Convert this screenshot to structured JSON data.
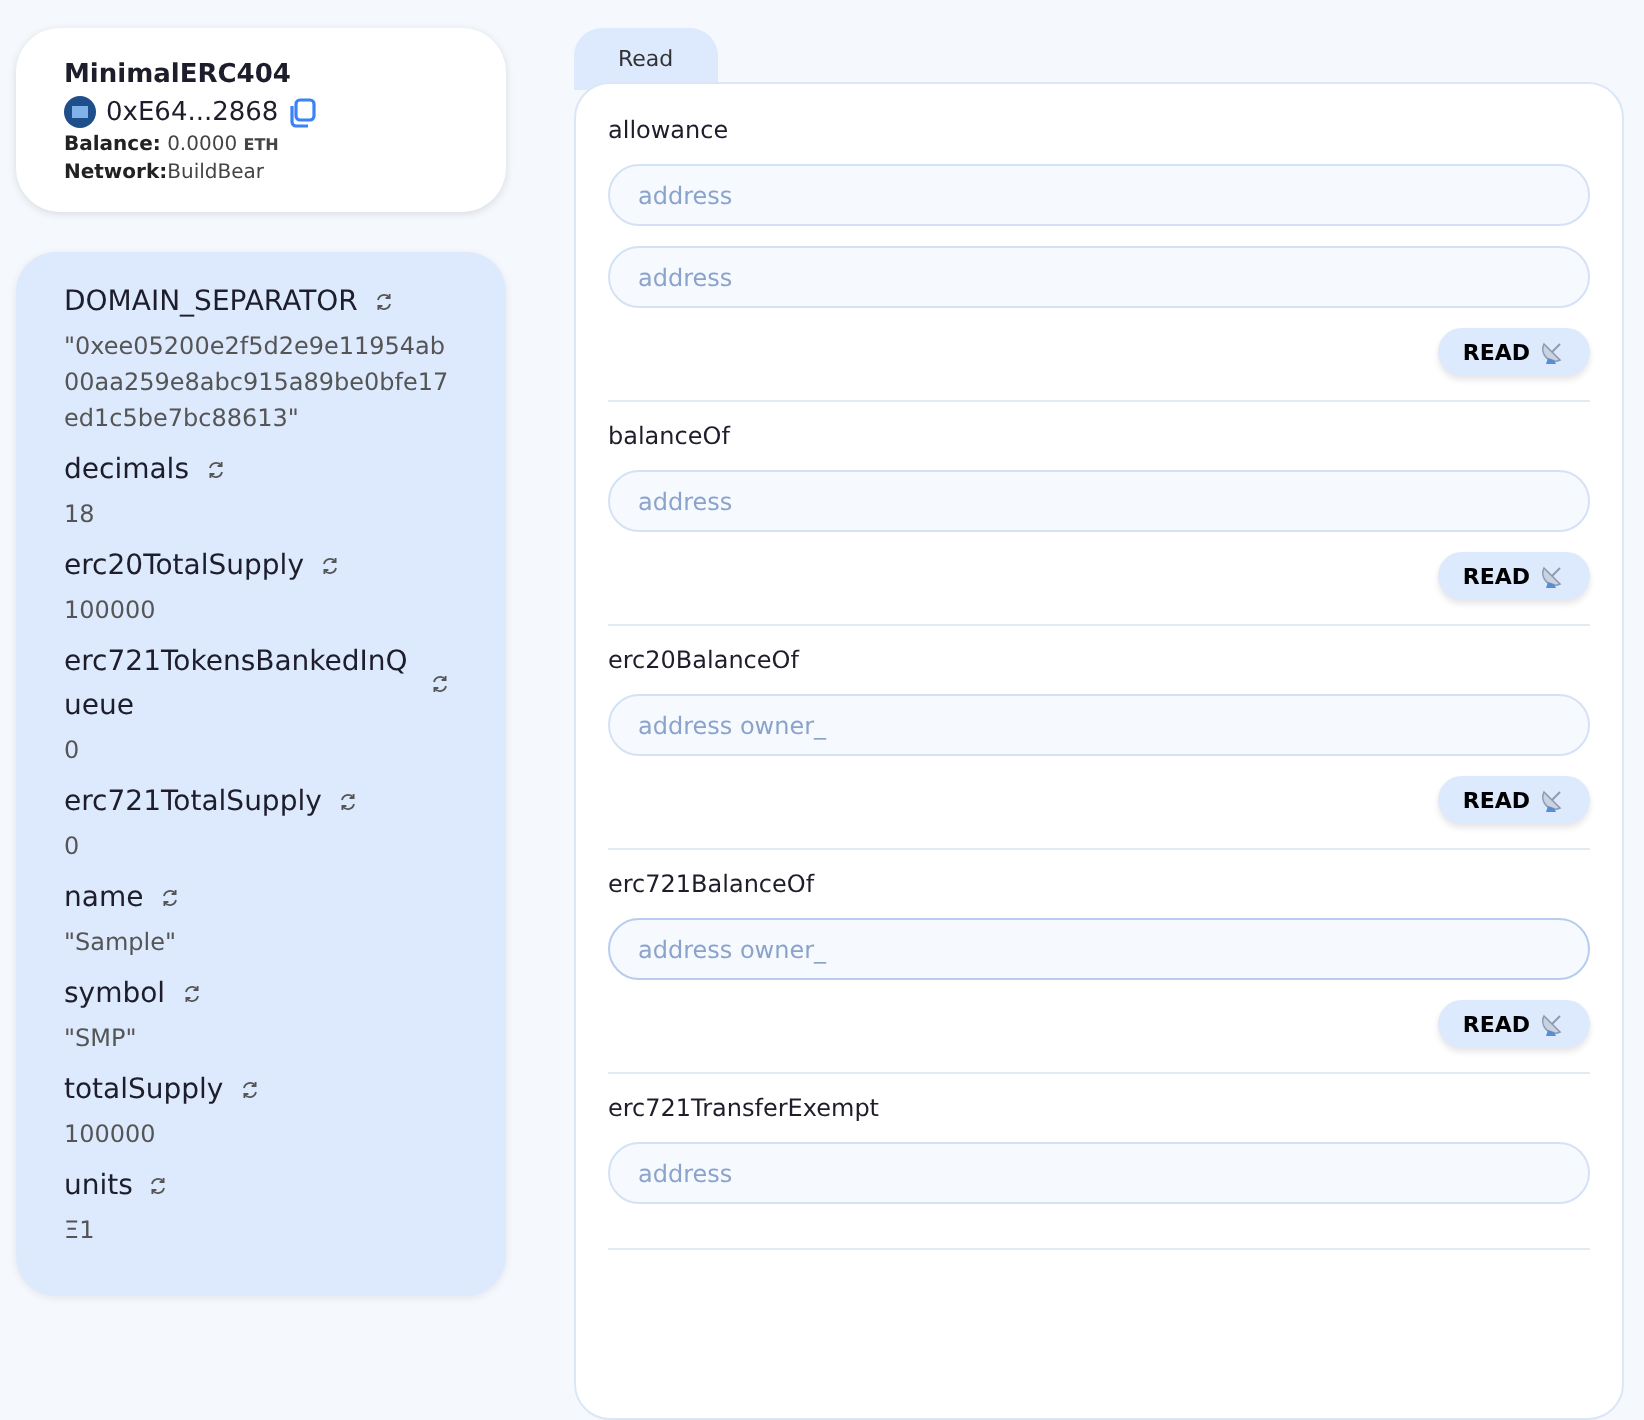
{
  "contract": {
    "name": "MinimalERC404",
    "address": "0xE64...2868",
    "balance_label": "Balance:",
    "balance_value": "0.0000",
    "balance_unit": "ETH",
    "network_label": "Network:",
    "network_value": "BuildBear"
  },
  "variables": [
    {
      "name": "DOMAIN_SEPARATOR",
      "value": "\"0xee05200e2f5d2e9e11954ab00aa259e8abc915a89be0bfe17ed1c5be7bc88613\""
    },
    {
      "name": "decimals",
      "value": "18"
    },
    {
      "name": "erc20TotalSupply",
      "value": "100000"
    },
    {
      "name": "erc721TokensBankedInQueue",
      "value": "0"
    },
    {
      "name": "erc721TotalSupply",
      "value": "0"
    },
    {
      "name": "name",
      "value": "\"Sample\""
    },
    {
      "name": "symbol",
      "value": "\"SMP\""
    },
    {
      "name": "totalSupply",
      "value": "100000"
    },
    {
      "name": "units",
      "value": "Ξ1"
    }
  ],
  "tabs": [
    {
      "label": "Read",
      "selected": true
    }
  ],
  "functions": [
    {
      "name": "allowance",
      "inputs": [
        {
          "placeholder": "address",
          "focused": false
        },
        {
          "placeholder": "address",
          "focused": false
        }
      ],
      "button": "READ"
    },
    {
      "name": "balanceOf",
      "inputs": [
        {
          "placeholder": "address",
          "focused": false
        }
      ],
      "button": "READ"
    },
    {
      "name": "erc20BalanceOf",
      "inputs": [
        {
          "placeholder": "address owner_",
          "focused": false
        }
      ],
      "button": "READ"
    },
    {
      "name": "erc721BalanceOf",
      "inputs": [
        {
          "placeholder": "address owner_",
          "focused": true
        }
      ],
      "button": "READ"
    },
    {
      "name": "erc721TransferExempt",
      "inputs": [
        {
          "placeholder": "address",
          "focused": false
        }
      ]
    }
  ]
}
